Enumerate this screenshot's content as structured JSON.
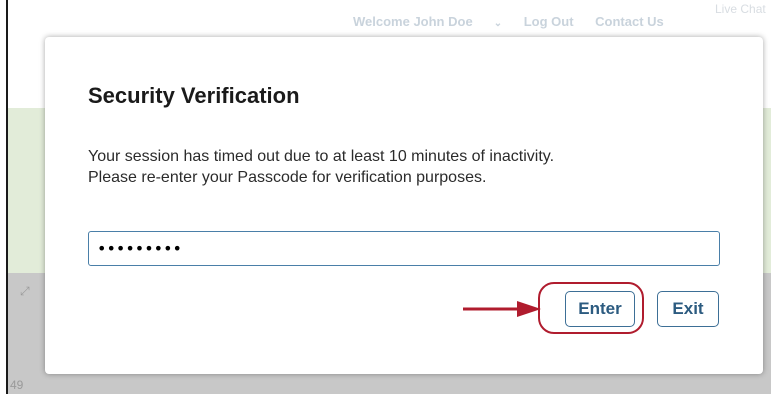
{
  "topnav": {
    "welcome": "Welcome John Doe",
    "logout": "Log Out",
    "contact": "Contact Us",
    "live_chat": "Live Chat"
  },
  "background": {
    "page_number": "49"
  },
  "modal": {
    "title": "Security Verification",
    "message_line1": "Your session has timed out due to at least 10 minutes of inactivity.",
    "message_line2": "Please re-enter your Passcode for verification purposes.",
    "passcode_value": "dummypass",
    "enter_label": "Enter",
    "exit_label": "Exit"
  },
  "annotation": {
    "highlight_color": "#b01c2e"
  },
  "colors": {
    "button_text": "#2c5b80",
    "input_border": "#4a7fa8",
    "green_band": "#e2ecd9",
    "grey_band": "#c8c8c8"
  }
}
